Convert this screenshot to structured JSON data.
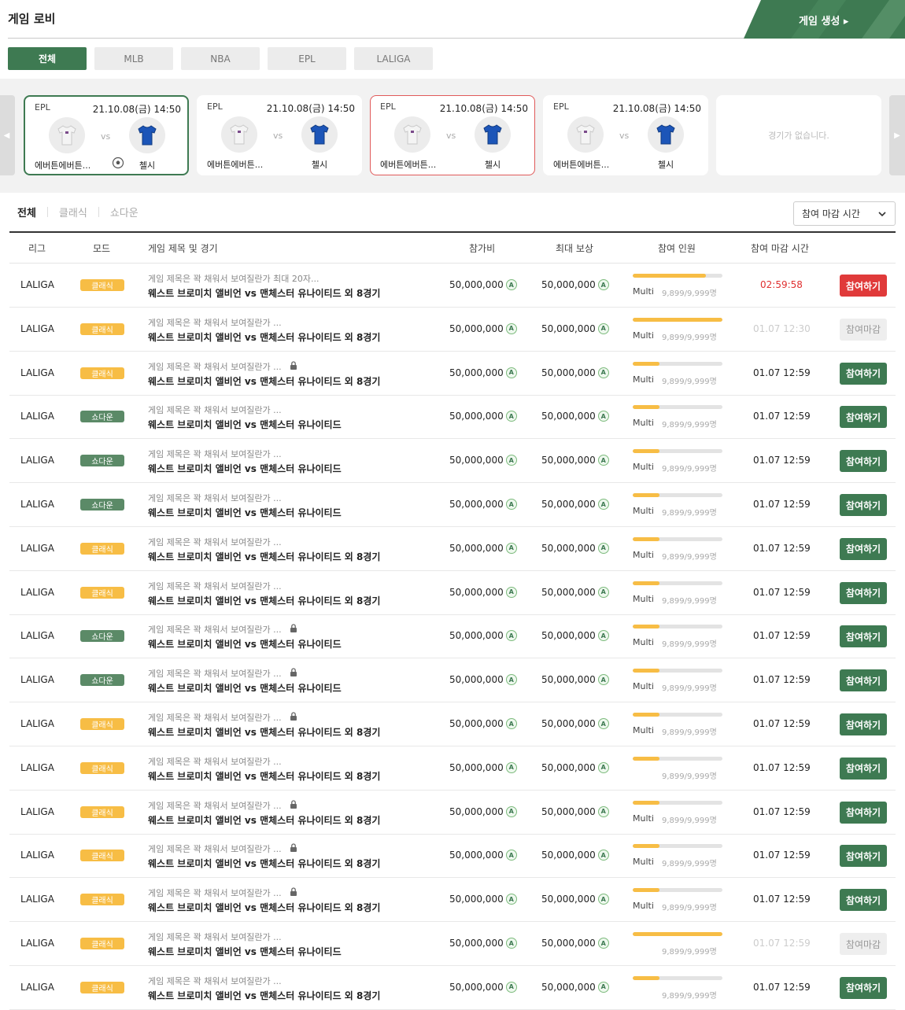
{
  "header": {
    "title": "게임 로비",
    "create_button": "게임 생성 ▸"
  },
  "league_tabs": [
    "전체",
    "MLB",
    "NBA",
    "EPL",
    "LALIGA"
  ],
  "carousel": {
    "cards": [
      {
        "league": "EPL",
        "date": "21.10.08(금) 14:50",
        "home": "에버튼에버튼...",
        "vs": "vs",
        "away": "첼시"
      },
      {
        "league": "EPL",
        "date": "21.10.08(금) 14:50",
        "home": "에버튼에버튼...",
        "vs": "vs",
        "away": "첼시"
      },
      {
        "league": "EPL",
        "date": "21.10.08(금) 14:50",
        "home": "에버튼에버튼...",
        "vs": "vs",
        "away": "첼시"
      },
      {
        "league": "EPL",
        "date": "21.10.08(금) 14:50",
        "home": "에버튼에버튼...",
        "vs": "vs",
        "away": "첼시"
      }
    ],
    "empty_text": "경기가 없습니다.",
    "prev_arrow": "◀",
    "next_arrow": "▶"
  },
  "mode_tabs": [
    "전체",
    "클래식",
    "쇼다운"
  ],
  "sort": {
    "label": "참여 마감 시간"
  },
  "table": {
    "headers": {
      "league": "리그",
      "mode": "모드",
      "title": "게임 제목 및 경기",
      "fee": "참가비",
      "reward": "최대 보상",
      "entrants": "참여 인원",
      "deadline": "참여 마감 시간"
    },
    "rows": [
      {
        "league": "LALIGA",
        "mode": "클래식",
        "title": "게임 제목은 꽉 채워서 보여질란가 최대 20자...",
        "locked": false,
        "match": "웨스트 브로미치 앨비언 vs 맨체스터 유나이티드 외 8경기",
        "fee": "50,000,000",
        "reward": "50,000,000",
        "fill": 0.82,
        "multi": "Multi",
        "count": "9,899/9,999명",
        "deadline": "02:59:58",
        "deadline_style": "red",
        "action": "참여하기",
        "action_style": "red"
      },
      {
        "league": "LALIGA",
        "mode": "클래식",
        "title": "게임 제목은 꽉 채워서 보여질란가 ...",
        "locked": false,
        "match": "웨스트 브로미치 앨비언 vs 맨체스터 유나이티드 외 8경기",
        "fee": "50,000,000",
        "reward": "50,000,000",
        "fill": 1.0,
        "multi": "Multi",
        "count": "9,899/9,999명",
        "deadline": "01.07 12:30",
        "deadline_style": "muted",
        "action": "참여마감",
        "action_style": "closed"
      },
      {
        "league": "LALIGA",
        "mode": "클래식",
        "title": "게임 제목은 꽉 채워서 보여질란가 ...",
        "locked": true,
        "match": "웨스트 브로미치 앨비언 vs 맨체스터 유나이티드 외 8경기",
        "fee": "50,000,000",
        "reward": "50,000,000",
        "fill": 0.3,
        "multi": "Multi",
        "count": "9,899/9,999명",
        "deadline": "01.07 12:59",
        "deadline_style": "normal",
        "action": "참여하기",
        "action_style": "green"
      },
      {
        "league": "LALIGA",
        "mode": "쇼다운",
        "title": "게임 제목은 꽉 채워서 보여질란가 ...",
        "locked": false,
        "match": "웨스트 브로미치 앨비언 vs 맨체스터 유나이티드",
        "fee": "50,000,000",
        "reward": "50,000,000",
        "fill": 0.3,
        "multi": "Multi",
        "count": "9,899/9,999명",
        "deadline": "01.07 12:59",
        "deadline_style": "normal",
        "action": "참여하기",
        "action_style": "green"
      },
      {
        "league": "LALIGA",
        "mode": "쇼다운",
        "title": "게임 제목은 꽉 채워서 보여질란가 ...",
        "locked": false,
        "match": "웨스트 브로미치 앨비언 vs 맨체스터 유나이티드",
        "fee": "50,000,000",
        "reward": "50,000,000",
        "fill": 0.3,
        "multi": "Multi",
        "count": "9,899/9,999명",
        "deadline": "01.07 12:59",
        "deadline_style": "normal",
        "action": "참여하기",
        "action_style": "green"
      },
      {
        "league": "LALIGA",
        "mode": "쇼다운",
        "title": "게임 제목은 꽉 채워서 보여질란가 ...",
        "locked": false,
        "match": "웨스트 브로미치 앨비언 vs 맨체스터 유나이티드",
        "fee": "50,000,000",
        "reward": "50,000,000",
        "fill": 0.3,
        "multi": "Multi",
        "count": "9,899/9,999명",
        "deadline": "01.07 12:59",
        "deadline_style": "normal",
        "action": "참여하기",
        "action_style": "green"
      },
      {
        "league": "LALIGA",
        "mode": "클래식",
        "title": "게임 제목은 꽉 채워서 보여질란가 ...",
        "locked": false,
        "match": "웨스트 브로미치 앨비언 vs 맨체스터 유나이티드 외 8경기",
        "fee": "50,000,000",
        "reward": "50,000,000",
        "fill": 0.3,
        "multi": "Multi",
        "count": "9,899/9,999명",
        "deadline": "01.07 12:59",
        "deadline_style": "normal",
        "action": "참여하기",
        "action_style": "green"
      },
      {
        "league": "LALIGA",
        "mode": "클래식",
        "title": "게임 제목은 꽉 채워서 보여질란가 ...",
        "locked": false,
        "match": "웨스트 브로미치 앨비언 vs 맨체스터 유나이티드 외 8경기",
        "fee": "50,000,000",
        "reward": "50,000,000",
        "fill": 0.3,
        "multi": "Multi",
        "count": "9,899/9,999명",
        "deadline": "01.07 12:59",
        "deadline_style": "normal",
        "action": "참여하기",
        "action_style": "green"
      },
      {
        "league": "LALIGA",
        "mode": "쇼다운",
        "title": "게임 제목은 꽉 채워서 보여질란가 ...",
        "locked": true,
        "match": "웨스트 브로미치 앨비언 vs 맨체스터 유나이티드",
        "fee": "50,000,000",
        "reward": "50,000,000",
        "fill": 0.3,
        "multi": "Multi",
        "count": "9,899/9,999명",
        "deadline": "01.07 12:59",
        "deadline_style": "normal",
        "action": "참여하기",
        "action_style": "green"
      },
      {
        "league": "LALIGA",
        "mode": "쇼다운",
        "title": "게임 제목은 꽉 채워서 보여질란가 ...",
        "locked": true,
        "match": "웨스트 브로미치 앨비언 vs 맨체스터 유나이티드",
        "fee": "50,000,000",
        "reward": "50,000,000",
        "fill": 0.3,
        "multi": "Multi",
        "count": "9,899/9,999명",
        "deadline": "01.07 12:59",
        "deadline_style": "normal",
        "action": "참여하기",
        "action_style": "green"
      },
      {
        "league": "LALIGA",
        "mode": "클래식",
        "title": "게임 제목은 꽉 채워서 보여질란가 ...",
        "locked": true,
        "match": "웨스트 브로미치 앨비언 vs 맨체스터 유나이티드 외 8경기",
        "fee": "50,000,000",
        "reward": "50,000,000",
        "fill": 0.3,
        "multi": "Multi",
        "count": "9,899/9,999명",
        "deadline": "01.07 12:59",
        "deadline_style": "normal",
        "action": "참여하기",
        "action_style": "green"
      },
      {
        "league": "LALIGA",
        "mode": "클래식",
        "title": "게임 제목은 꽉 채워서 보여질란가 ...",
        "locked": false,
        "match": "웨스트 브로미치 앨비언 vs 맨체스터 유나이티드 외 8경기",
        "fee": "50,000,000",
        "reward": "50,000,000",
        "fill": 0.3,
        "multi": "",
        "count": "9,899/9,999명",
        "deadline": "01.07 12:59",
        "deadline_style": "normal",
        "action": "참여하기",
        "action_style": "green"
      },
      {
        "league": "LALIGA",
        "mode": "클래식",
        "title": "게임 제목은 꽉 채워서 보여질란가 ...",
        "locked": true,
        "match": "웨스트 브로미치 앨비언 vs 맨체스터 유나이티드 외 8경기",
        "fee": "50,000,000",
        "reward": "50,000,000",
        "fill": 0.3,
        "multi": "Multi",
        "count": "9,899/9,999명",
        "deadline": "01.07 12:59",
        "deadline_style": "normal",
        "action": "참여하기",
        "action_style": "green"
      },
      {
        "league": "LALIGA",
        "mode": "클래식",
        "title": "게임 제목은 꽉 채워서 보여질란가 ...",
        "locked": true,
        "match": "웨스트 브로미치 앨비언 vs 맨체스터 유나이티드 외 8경기",
        "fee": "50,000,000",
        "reward": "50,000,000",
        "fill": 0.3,
        "multi": "Multi",
        "count": "9,899/9,999명",
        "deadline": "01.07 12:59",
        "deadline_style": "normal",
        "action": "참여하기",
        "action_style": "green"
      },
      {
        "league": "LALIGA",
        "mode": "클래식",
        "title": "게임 제목은 꽉 채워서 보여질란가 ...",
        "locked": true,
        "match": "웨스트 브로미치 앨비언 vs 맨체스터 유나이티드 외 8경기",
        "fee": "50,000,000",
        "reward": "50,000,000",
        "fill": 0.3,
        "multi": "Multi",
        "count": "9,899/9,999명",
        "deadline": "01.07 12:59",
        "deadline_style": "normal",
        "action": "참여하기",
        "action_style": "green"
      },
      {
        "league": "LALIGA",
        "mode": "클래식",
        "title": "게임 제목은 꽉 채워서 보여질란가 ...",
        "locked": false,
        "match": "웨스트 브로미치 앨비언 vs 맨체스터 유나이티드",
        "fee": "50,000,000",
        "reward": "50,000,000",
        "fill": 1.0,
        "multi": "",
        "count": "9,899/9,999명",
        "deadline": "01.07 12:59",
        "deadline_style": "muted",
        "action": "참여마감",
        "action_style": "closed"
      },
      {
        "league": "LALIGA",
        "mode": "클래식",
        "title": "게임 제목은 꽉 채워서 보여질란가 ...",
        "locked": false,
        "match": "웨스트 브로미치 앨비언 vs 맨체스터 유나이티드 외 8경기",
        "fee": "50,000,000",
        "reward": "50,000,000",
        "fill": 0.3,
        "multi": "",
        "count": "9,899/9,999명",
        "deadline": "01.07 12:59",
        "deadline_style": "normal",
        "action": "참여하기",
        "action_style": "green"
      }
    ]
  },
  "colors": {
    "brand_green": "#3e7a52",
    "classic_badge": "#f7bd45",
    "showdown_badge": "#5b8a67",
    "deadline_red": "#e03030",
    "progress_fill": "#f7bd45"
  },
  "icons": {
    "coin": "A",
    "lock": "lock-icon",
    "chevron": "chevron-down-icon",
    "ball": "soccer-ball-icon"
  }
}
